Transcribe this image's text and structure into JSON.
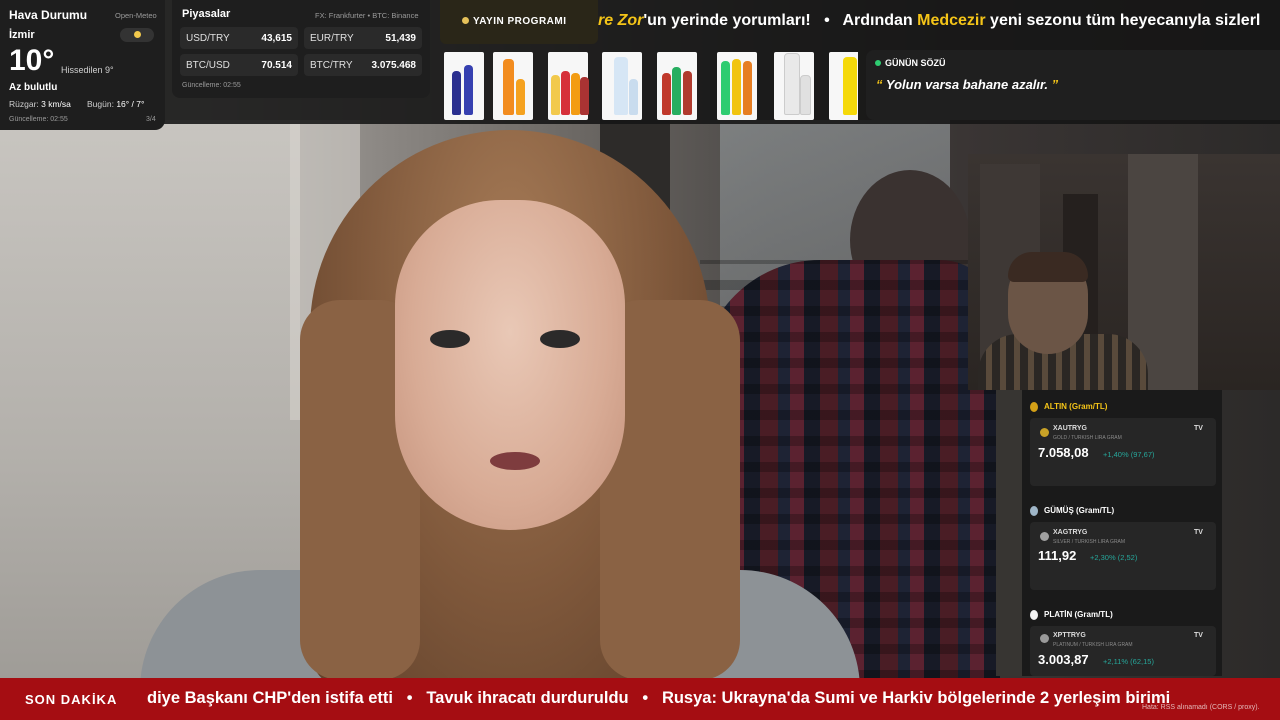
{
  "weather": {
    "title": "Hava Durumu",
    "source": "Open-Meteo",
    "city": "İzmir",
    "temperature": "10°",
    "feels_like": "Hissedilen 9°",
    "description": "Az bulutlu",
    "wind_label": "Rüzgar:",
    "wind_value": "3 km/sa",
    "today_label": "Bugün:",
    "today_value": "16° / 7°",
    "updated": "Güncelleme: 02:55",
    "page": "3/4",
    "icon": "partly-cloudy-icon"
  },
  "markets": {
    "title": "Piyasalar",
    "source": "FX: Frankfurter • BTC: Binance",
    "rows": [
      {
        "key": "USD/TRY",
        "value": "43,615"
      },
      {
        "key": "EUR/TRY",
        "value": "51,439"
      },
      {
        "key": "BTC/USD",
        "value": "70.514"
      },
      {
        "key": "BTC/TRY",
        "value": "3.075.468"
      }
    ],
    "updated": "Güncelleme: 02:55"
  },
  "schedule": {
    "label": "YAYIN PROGRAMI",
    "ticker_part1": "re Zor",
    "ticker_part2": "'un yerinde yorumları!",
    "ticker_sep": "•",
    "ticker_part3": "Ardından",
    "ticker_part4": "Medcezir",
    "ticker_part5": "yeni sezonu tüm heyecanıyla sizlerl"
  },
  "quote": {
    "title": "GÜNÜN SÖZÜ",
    "open": "“",
    "text": "Yolun varsa bahane azalır.",
    "close": "”"
  },
  "commodities": [
    {
      "header": "ALTIN (Gram/TL)",
      "symbol": "XAUTRYG",
      "sub": "GOLD / TURKISH LIRA GRAM",
      "price": "7.058,08",
      "change": "+1,40% (97,67)",
      "medal_color": "#d4a017",
      "coin_color": "#c9a227"
    },
    {
      "header": "GÜMÜŞ (Gram/TL)",
      "symbol": "XAGTRYG",
      "sub": "SILVER / TURKISH LIRA GRAM",
      "price": "111,92",
      "change": "+2,30% (2,52)",
      "medal_color": "#9fb6c8",
      "coin_color": "#a0a0a0"
    },
    {
      "header": "PLATİN (Gram/TL)",
      "symbol": "XPTTRYG",
      "sub": "PLATINUM / TURKISH LIRA GRAM",
      "price": "3.003,87",
      "change": "+2,11% (62,15)",
      "medal_color": "#f2f2f2",
      "coin_color": "#9a9a9a"
    }
  ],
  "tv_badge": "TV",
  "breaking": {
    "label": "SON DAKİKA",
    "sep": "•",
    "item1": "diye Başkanı CHP'den istifa etti",
    "item2": "Tavuk ihracatı durduruldu",
    "item3": "Rusya: Ukrayna'da Sumi ve Harkiv bölgelerinde 2 yerleşim birimi",
    "error": "Hata: RSS alınamadı (CORS / proxy)."
  },
  "colors": {
    "accent": "#f5c518",
    "breaking_bg": "#a50d12",
    "positive": "#26a69a"
  }
}
